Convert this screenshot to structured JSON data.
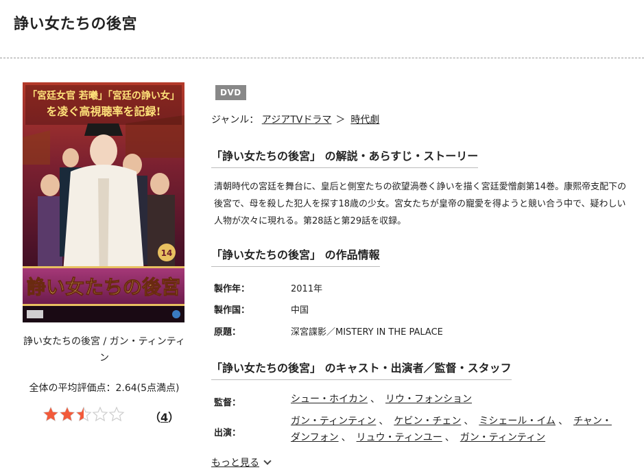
{
  "page": {
    "title": "諍い女たちの後宮"
  },
  "product": {
    "cover_caption": "諍い女たちの後宮 / ガン・ティンティン",
    "cover_text": {
      "banner_line1": "「宮廷女官 若曦」「宮廷の諍い女」",
      "banner_line2": "を凌ぐ高視聴率を記録!",
      "title": "諍い女たちの後宮",
      "volume": "14"
    },
    "rating": {
      "label": "全体の平均評価点：2.64(5点満点)",
      "value": 2.64,
      "max": 5,
      "review_count": "4",
      "open_paren": "（",
      "close_paren": "）"
    },
    "format_badge": "DVD",
    "genre": {
      "label": "ジャンル：",
      "path": [
        "アジアTVドラマ",
        "時代劇"
      ],
      "separator": "＞"
    }
  },
  "sections": {
    "synopsis": {
      "heading_title": "「諍い女たちの後宮」",
      "heading_suffix": "の解説・あらすじ・ストーリー",
      "text": "清朝時代の宮廷を舞台に、皇后と側室たちの欲望渦巻く諍いを描く宮廷愛憎劇第14巻。康熙帝支配下の後宮で、母を殺した犯人を探す18歳の少女。宮女たちが皇帝の寵愛を得ようと競い合う中で、疑わしい人物が次々に現れる。第28話と第29話を収録。"
    },
    "info": {
      "heading_title": "「諍い女たちの後宮」",
      "heading_suffix": "の作品情報",
      "rows": [
        {
          "label": "製作年：",
          "value": "2011年"
        },
        {
          "label": "製作国：",
          "value": "中国"
        },
        {
          "label": "原題：",
          "value": "深宮諜影／MISTERY IN THE PALACE"
        }
      ]
    },
    "cast": {
      "heading_title": "「諍い女たちの後宮」",
      "heading_suffix": "のキャスト・出演者／監督・スタッフ",
      "director_label": "監督：",
      "directors": [
        "シュー・ホイカン",
        "リウ・フォンション"
      ],
      "cast_label": "出演：",
      "cast_line1": [
        "ガン・ティンティン",
        "ケビン・チェン",
        "ミシェール・イム",
        "チャン・"
      ],
      "cast_line2": [
        "ダンフォン",
        "リュウ・ティンユー",
        "ガン・ティンティン"
      ],
      "separator": "、"
    },
    "more_label": "もっと見る"
  },
  "colors": {
    "star_filled": "#f25a3a",
    "star_empty": "#cccccc",
    "badge": "#888888"
  }
}
